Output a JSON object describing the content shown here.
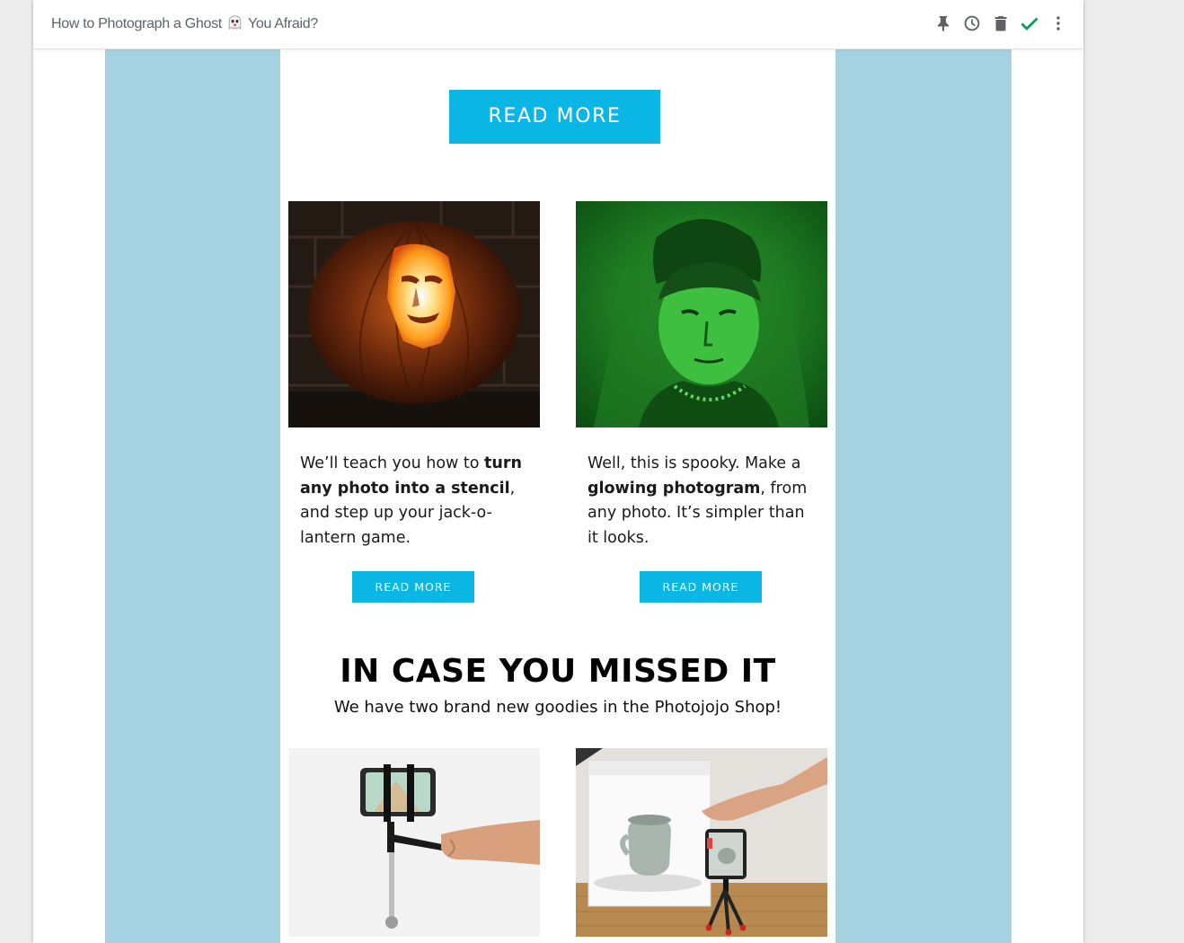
{
  "email": {
    "subject_before": "How to Photograph a Ghost",
    "subject_after": "You Afraid?"
  },
  "toolbar": {
    "icons": [
      "pin-icon",
      "snooze-clock-icon",
      "trash-icon",
      "done-check-icon",
      "more-vert-icon"
    ]
  },
  "body": {
    "main_button": "READ MORE",
    "article1": {
      "text_1": "We’ll teach you how to ",
      "bold": "turn any photo into a stencil",
      "text_2": ", and step up your jack-o-lantern game.",
      "button": "READ MORE"
    },
    "article2": {
      "text_1": "Well, this is spooky. Make a ",
      "bold": "glowing photogram",
      "text_2": ", from any photo. It’s simpler than it looks.",
      "button": "READ MORE"
    },
    "missed_heading": "IN CASE YOU MISSED IT",
    "missed_subheading": "We have two brand new goodies in the Photojojo Shop!"
  },
  "colors": {
    "accent": "#0ab6e3",
    "side_background": "#a6d3e2",
    "done_check": "#0f9d58"
  }
}
